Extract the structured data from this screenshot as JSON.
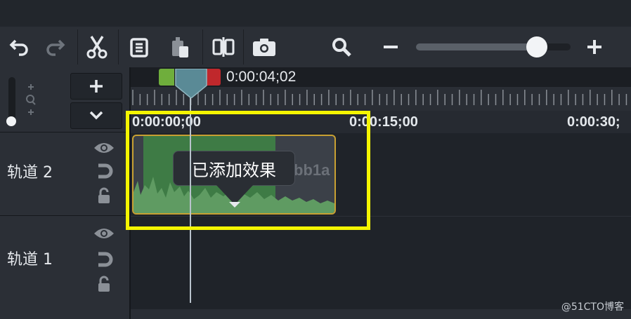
{
  "toolbar": {
    "icons": [
      "undo-icon",
      "redo-icon",
      "cut-icon",
      "copy-icon",
      "paste-icon",
      "split-icon",
      "camera-icon",
      "zoom-icon",
      "zoom-out-icon",
      "zoom-in-icon"
    ],
    "zoom_level": 0.78
  },
  "playhead": {
    "time": "0:00:04;02"
  },
  "ruler": {
    "timecodes": [
      "0:00:00;00",
      "0:00:15;00",
      "0:00:30;"
    ]
  },
  "tracks": [
    {
      "label": "轨道 2"
    },
    {
      "label": "轨道 1"
    }
  ],
  "clip": {
    "id_text": "bb1a"
  },
  "tooltip": {
    "text": "已添加效果"
  },
  "watermark": {
    "text": "@51CTO博客"
  },
  "colors": {
    "highlight": "#f5f500",
    "clip_border": "#c8a032",
    "audio": "#3e7b45"
  }
}
